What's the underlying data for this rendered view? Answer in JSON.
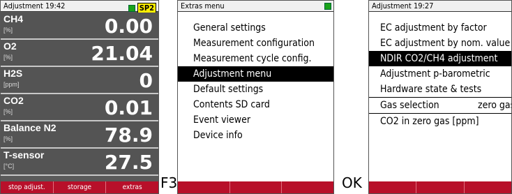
{
  "screen1": {
    "title": "Adjustment  19:42",
    "badge": "SP2",
    "indicator_color": "#1aa31a",
    "rows": [
      {
        "name": "CH4",
        "unit": "[%]",
        "value": "0.00"
      },
      {
        "name": "O2",
        "unit": "[%]",
        "value": "21.04"
      },
      {
        "name": "H2S",
        "unit": "[ppm]",
        "value": "0"
      },
      {
        "name": "CO2",
        "unit": "[%]",
        "value": "0.01"
      },
      {
        "name": "Balance N2",
        "unit": "[%]",
        "value": "78.9"
      },
      {
        "name": "T-sensor",
        "unit": "[°C]",
        "value": "27.5"
      }
    ],
    "softkeys": [
      "stop adjust.",
      "storage",
      "extras"
    ]
  },
  "key1": "F3",
  "screen2": {
    "title": "Extras menu",
    "items": [
      "General settings",
      "Measurement configuration",
      "Measurement cycle config.",
      "Adjustment menu",
      "Default settings",
      "Contents SD card",
      "Event viewer",
      "Device info"
    ],
    "selected_index": 3
  },
  "key2": "OK",
  "screen3": {
    "title": "Adjustment  19:27",
    "items": [
      "EC adjustment by factor",
      "EC adjustment by nom. value",
      "NDIR CO2/CH4 adjustment",
      "Adjustment p-barometric",
      "Hardware state & tests"
    ],
    "selected_index": 2,
    "gas_selection_label": "Gas selection",
    "gas_selection_value": "zero gas",
    "co2_label": "CO2 in zero gas [ppm]"
  },
  "colors": {
    "softkey_bar": "#b8102a",
    "selection": "#000000"
  }
}
